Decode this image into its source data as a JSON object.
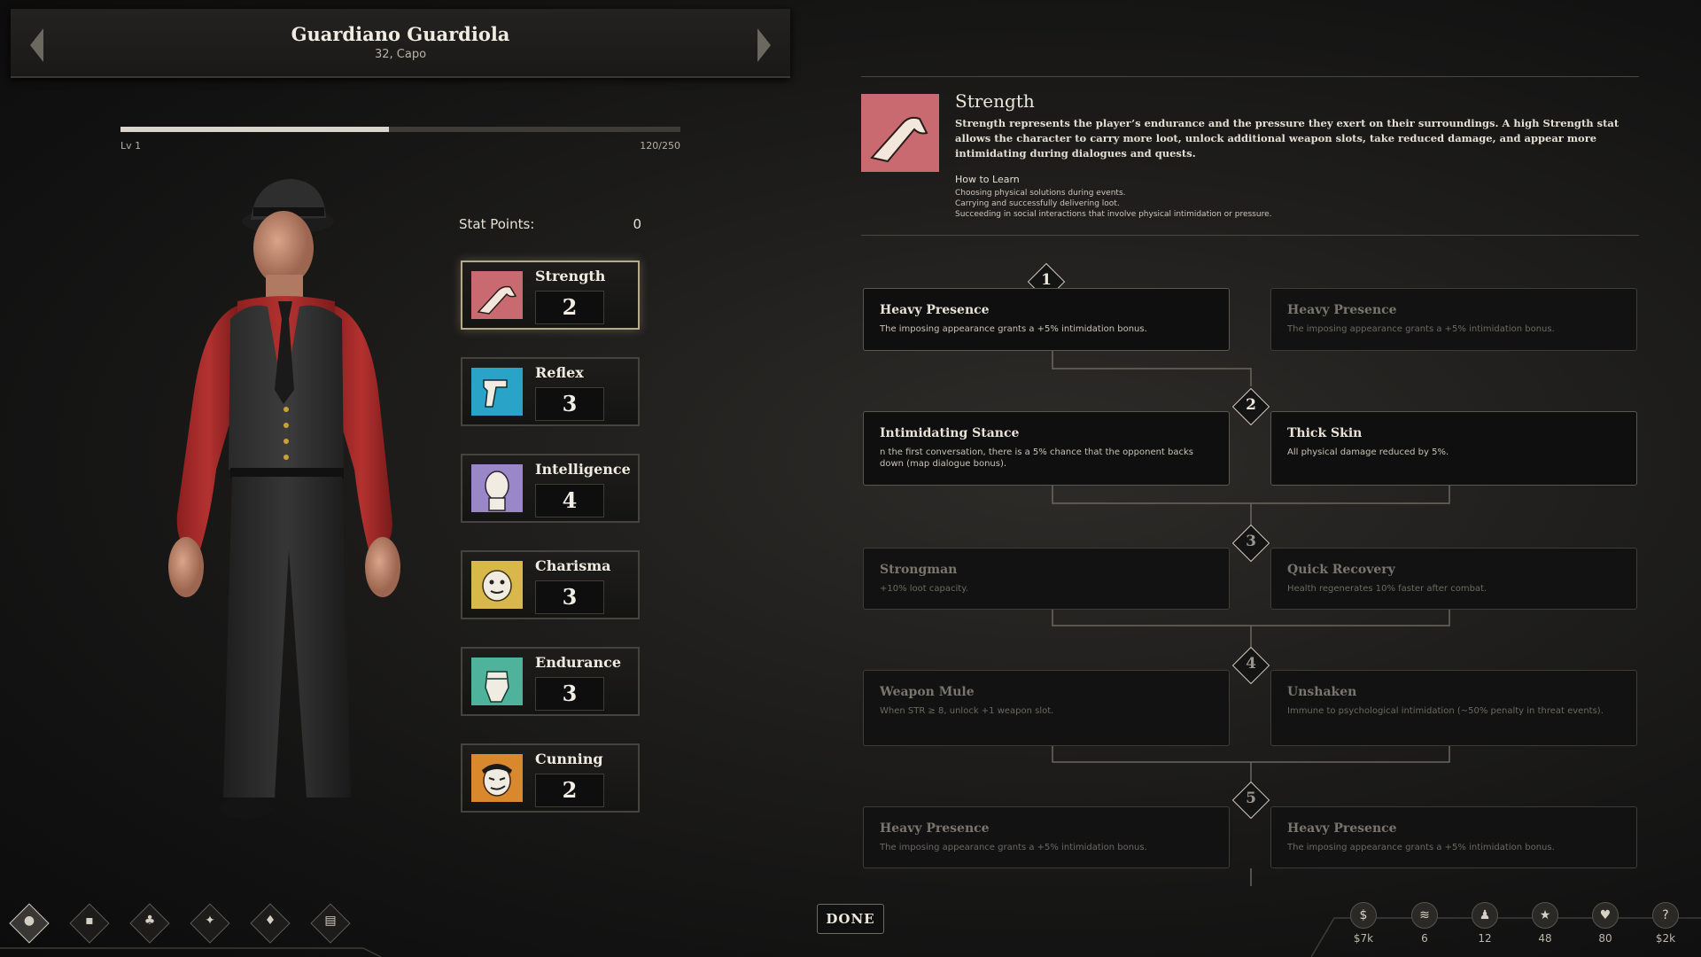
{
  "character": {
    "name": "Guardiano Guardiola",
    "subtitle": "32, Capo"
  },
  "xp": {
    "level_label": "Lv 1",
    "progress_label": "120/250",
    "progress_fraction": 0.48
  },
  "stat_points": {
    "label": "Stat Points:",
    "value": "0"
  },
  "stats": [
    {
      "name": "Strength",
      "value": "2",
      "selected": true,
      "icon": "flexed-arm-icon",
      "color": "#c86a6f"
    },
    {
      "name": "Reflex",
      "value": "3",
      "selected": false,
      "icon": "revolver-hand-icon",
      "color": "#2aa3c9"
    },
    {
      "name": "Intelligence",
      "value": "4",
      "selected": false,
      "icon": "bust-head-icon",
      "color": "#9a87c8"
    },
    {
      "name": "Charisma",
      "value": "3",
      "selected": false,
      "icon": "dice-face-icon",
      "color": "#d8b84a"
    },
    {
      "name": "Endurance",
      "value": "3",
      "selected": false,
      "icon": "raised-fist-icon",
      "color": "#4fb39b"
    },
    {
      "name": "Cunning",
      "value": "2",
      "selected": false,
      "icon": "sly-face-icon",
      "color": "#d9882e"
    }
  ],
  "detail": {
    "title": "Strength",
    "description": "Strength represents the player’s endurance and the pressure they exert on their surroundings. A high Strength stat allows the character to carry more loot, unlock additional weapon slots, take reduced damage, and appear more intimidating during dialogues and quests.",
    "how_to_learn_title": "How to Learn",
    "how_to_learn": [
      "Choosing physical solutions during events.",
      "Carrying and successfully delivering loot.",
      "Succeeding in social interactions that involve physical intimidation or pressure."
    ]
  },
  "tiers": [
    {
      "number": "1",
      "left": {
        "name": "Heavy Presence",
        "desc": "The imposing appearance grants a +5% intimidation bonus.",
        "active": true
      },
      "right": {
        "name": "Heavy Presence",
        "desc": "The imposing appearance grants a +5% intimidation bonus.",
        "active": false
      }
    },
    {
      "number": "2",
      "left": {
        "name": "Intimidating Stance",
        "desc": "n the first conversation, there is a 5% chance that the opponent backs down (map dialogue bonus).",
        "active": true
      },
      "right": {
        "name": "Thick Skin",
        "desc": "All physical damage reduced by 5%.",
        "active": true
      }
    },
    {
      "number": "3",
      "left": {
        "name": "Strongman",
        "desc": "+10% loot capacity.",
        "active": false
      },
      "right": {
        "name": "Quick Recovery",
        "desc": "Health regenerates 10% faster after combat.",
        "active": false
      }
    },
    {
      "number": "4",
      "left": {
        "name": "Weapon Mule",
        "desc": "When STR ≥ 8, unlock +1 weapon slot.",
        "active": false
      },
      "right": {
        "name": "Unshaken",
        "desc": "Immune to psychological intimidation (~50% penalty in threat events).",
        "active": false
      }
    },
    {
      "number": "5",
      "left": {
        "name": "Heavy Presence",
        "desc": "The imposing appearance grants a +5% intimidation bonus.",
        "active": false
      },
      "right": {
        "name": "Heavy Presence",
        "desc": "The imposing appearance grants a +5% intimidation bonus.",
        "active": false
      }
    }
  ],
  "done_label": "DONE",
  "nav": [
    {
      "icon": "character-icon",
      "active": true
    },
    {
      "icon": "inventory-icon",
      "active": false
    },
    {
      "icon": "crew-icon",
      "active": false
    },
    {
      "icon": "weapons-icon",
      "active": false
    },
    {
      "icon": "territory-icon",
      "active": false
    },
    {
      "icon": "journal-icon",
      "active": false
    }
  ],
  "resources": [
    {
      "icon": "money-icon",
      "value": "$7k"
    },
    {
      "icon": "ammo-icon",
      "value": "6"
    },
    {
      "icon": "crew-members-icon",
      "value": "12"
    },
    {
      "icon": "influence-icon",
      "value": "48"
    },
    {
      "icon": "health-icon",
      "value": "80"
    },
    {
      "icon": "debt-icon",
      "value": "$2k"
    }
  ]
}
